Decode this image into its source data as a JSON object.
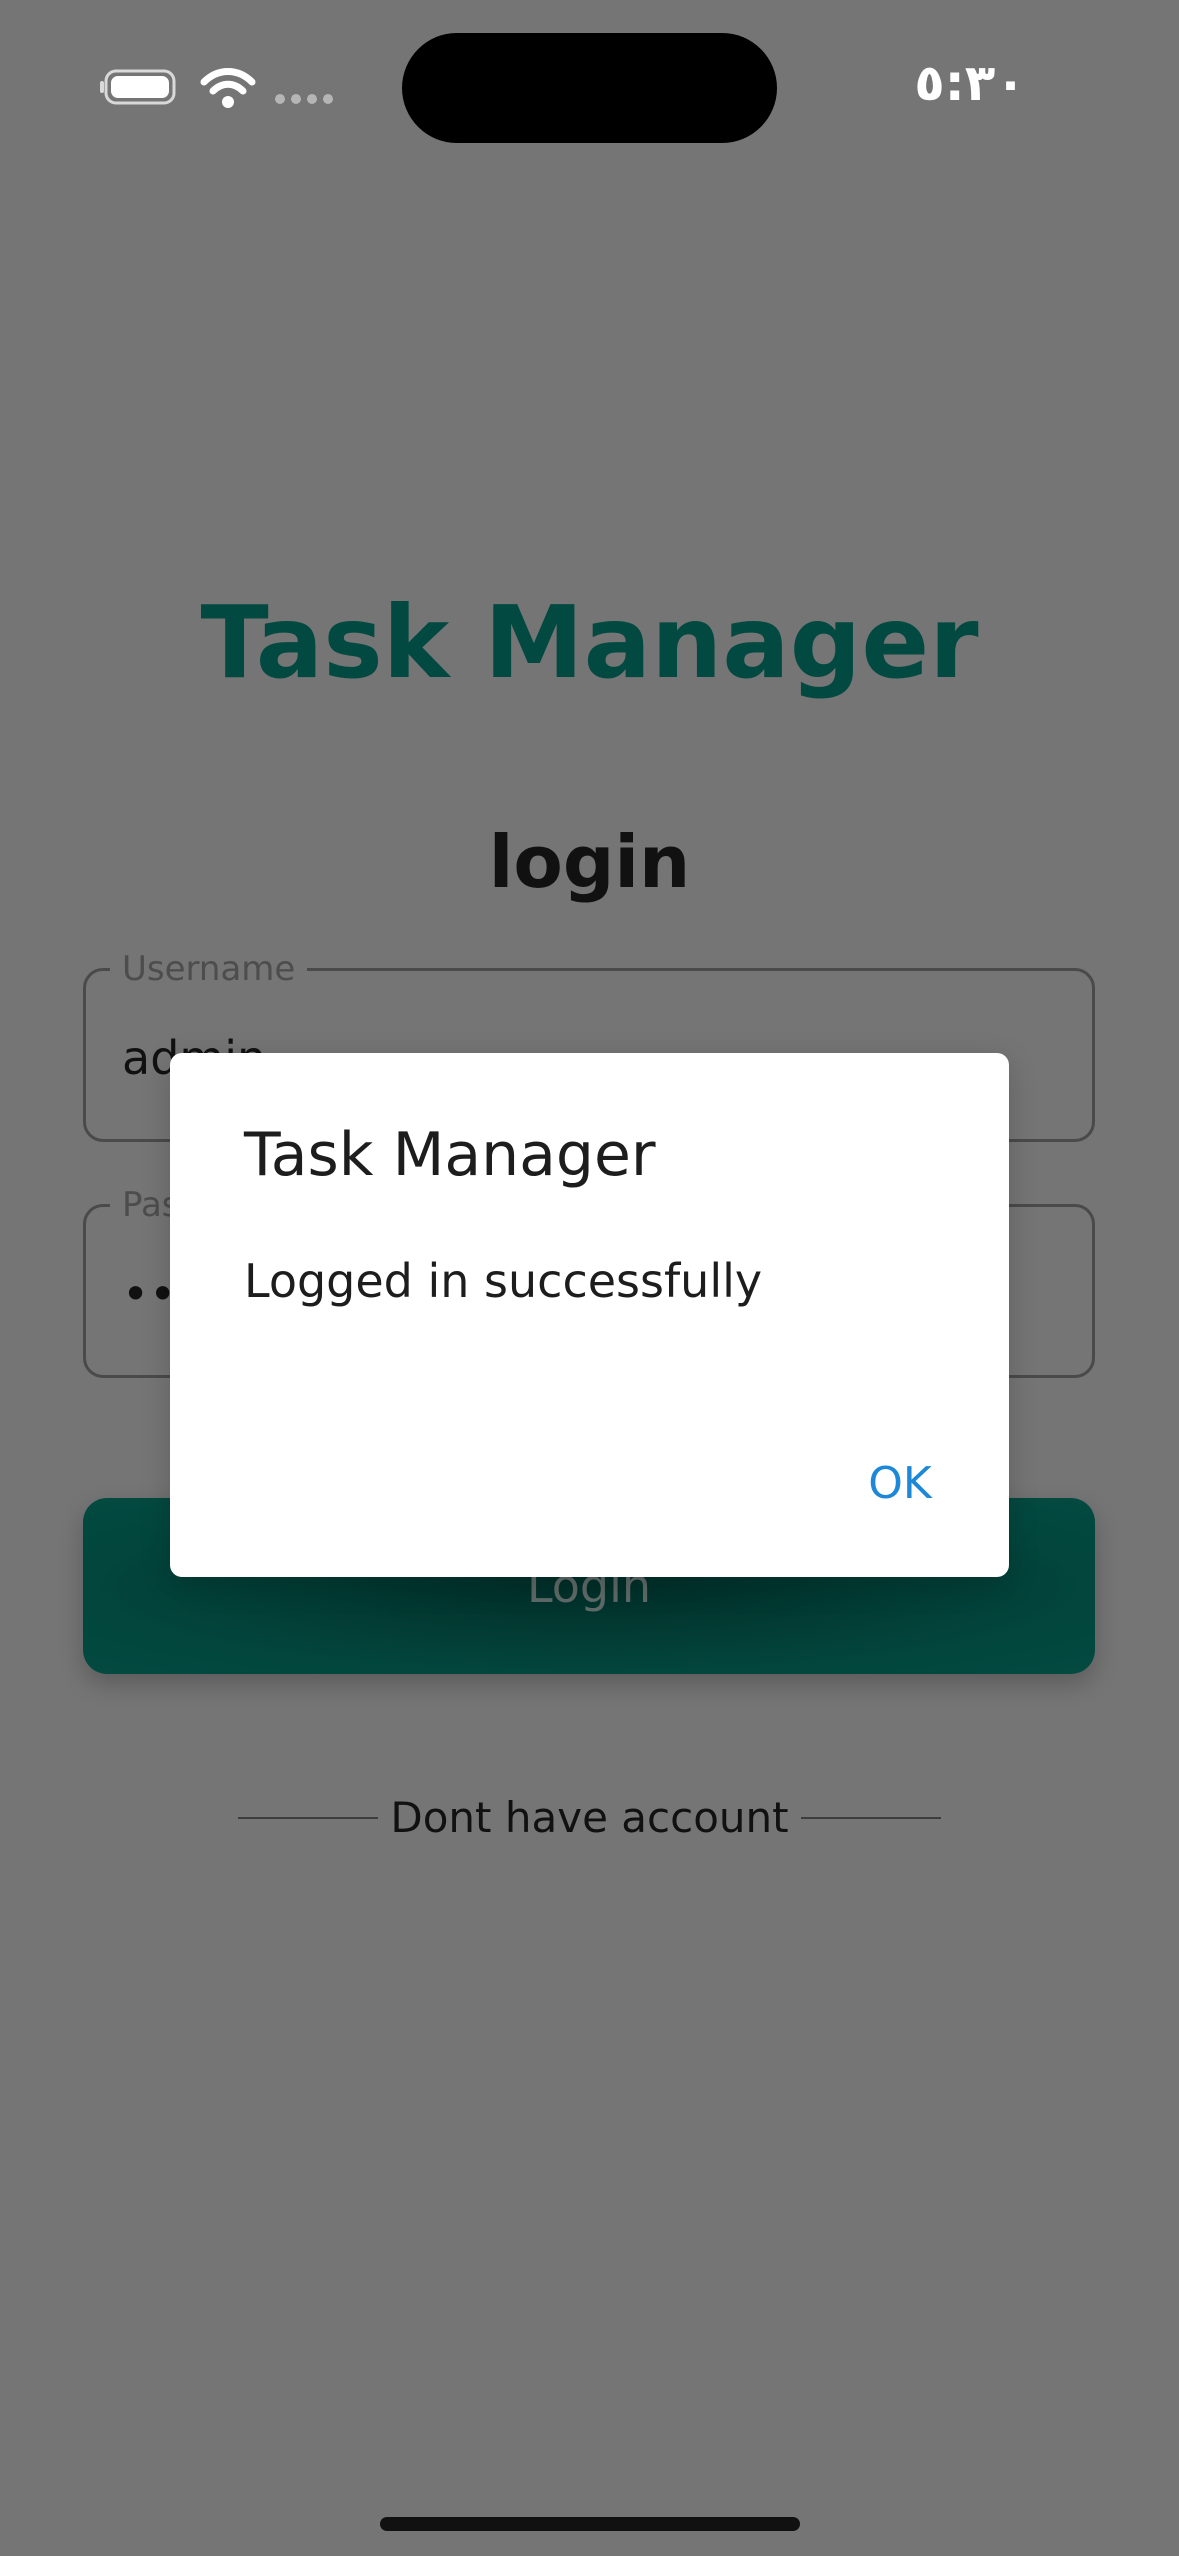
{
  "status_bar": {
    "time": "٥:٣٠",
    "icons": [
      "battery-icon",
      "wifi-icon",
      "cellular-signal-icon"
    ]
  },
  "app": {
    "title": "Task Manager",
    "screen_heading": "login"
  },
  "form": {
    "username": {
      "label": "Username",
      "value": "admin"
    },
    "password": {
      "label": "Password",
      "value": "••"
    },
    "login_button": "Login",
    "divider_text": "Dont have account"
  },
  "dialog": {
    "title": "Task Manager",
    "message": "Logged in successfully",
    "ok_button": "OK"
  },
  "colors": {
    "overlay_background": "#757575",
    "brand_teal": "#024a41",
    "accent_blue": "#1e88d8"
  }
}
